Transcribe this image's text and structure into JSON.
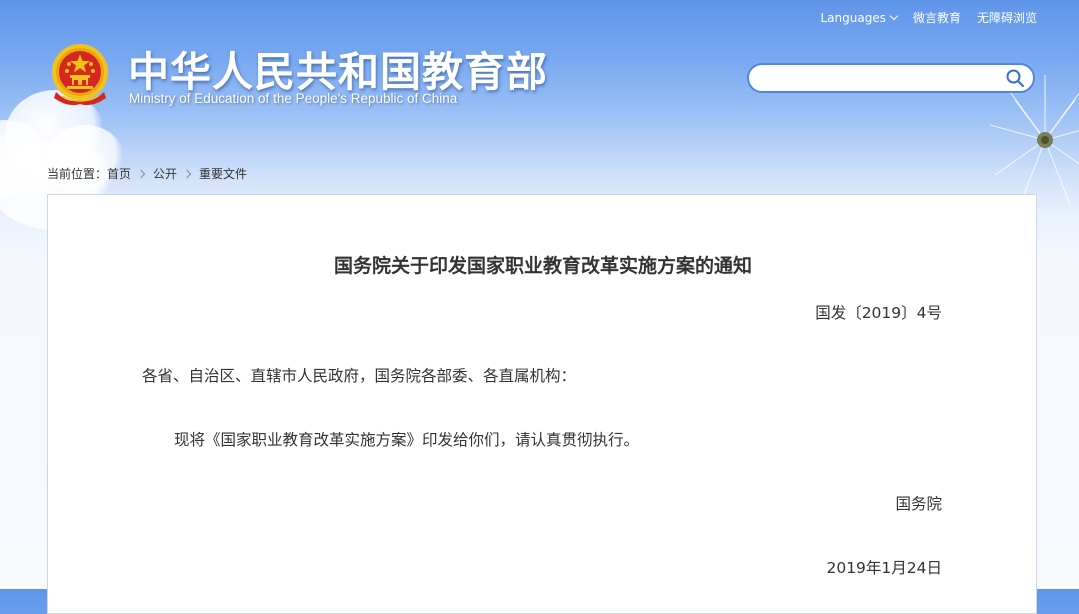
{
  "header": {
    "links": {
      "languages": "Languages",
      "weibo": "微言教育",
      "accessibility": "无障碍浏览"
    },
    "site_name": "中华人民共和国教育部",
    "site_name_en": "Ministry of Education of the People's Republic of China",
    "search": {
      "value": "",
      "placeholder": ""
    }
  },
  "breadcrumb": {
    "prefix": "当前位置：",
    "items": [
      "首页",
      "公开",
      "重要文件"
    ]
  },
  "document": {
    "title": "国务院关于印发国家职业教育改革实施方案的通知",
    "number": "国发〔2019〕4号",
    "salutation": "各省、自治区、直辖市人民政府，国务院各部委、各直属机构：",
    "body": "现将《国家职业教育改革实施方案》印发给你们，请认真贯彻执行。",
    "signer": "国务院",
    "date": "2019年1月24日"
  },
  "colors": {
    "header_blue": "#5f95ea",
    "search_border": "#4f85e0",
    "emblem_red": "#d7261f",
    "emblem_gold": "#f3c21b",
    "text": "#333333"
  },
  "icons": {
    "emblem": "national-emblem-icon",
    "search": "search-icon",
    "languages_dropdown": "chevron-down-icon",
    "breadcrumb_separator": "chevron-right-icon"
  }
}
